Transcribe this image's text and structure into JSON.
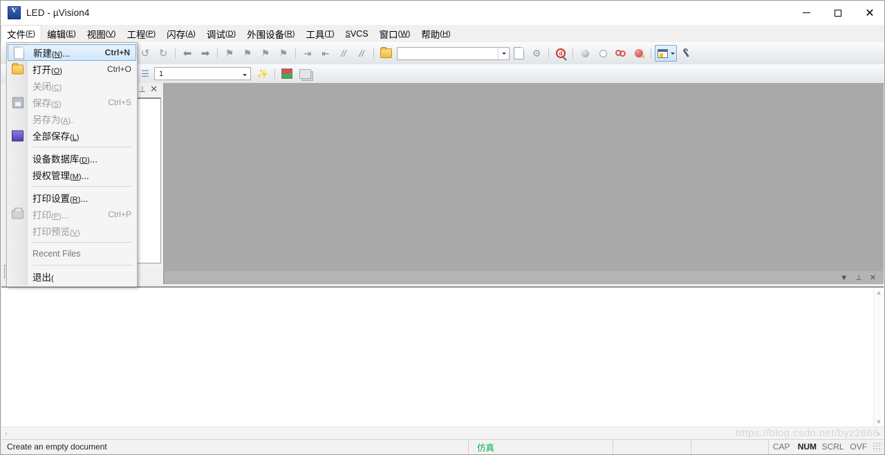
{
  "window": {
    "title": "LED  - µVision4",
    "icon": "uvision-logo-icon",
    "controls": {
      "minimize": "minimize-button",
      "maximize": "maximize-button",
      "close": "close-button"
    }
  },
  "menubar": {
    "items": [
      {
        "name": "文件",
        "key": "F",
        "open": true
      },
      {
        "name": "编辑",
        "key": "E",
        "open": false
      },
      {
        "name": "视图",
        "key": "V",
        "open": false
      },
      {
        "name": "工程",
        "key": "P",
        "open": false
      },
      {
        "name": "闪存",
        "key": "A",
        "open": false
      },
      {
        "name": "调试",
        "key": "D",
        "open": false
      },
      {
        "name": "外围设备",
        "key": "R",
        "open": false
      },
      {
        "name": "工具",
        "key": "T",
        "open": false
      },
      {
        "name": "SVCS",
        "key": "S",
        "plain": true,
        "open": false
      },
      {
        "name": "窗口",
        "key": "W",
        "open": false
      },
      {
        "name": "帮助",
        "key": "H",
        "open": false
      }
    ]
  },
  "file_menu": {
    "items": [
      {
        "label": "新建",
        "key": "N",
        "suffix": "...",
        "accel": "Ctrl+N",
        "icon": "new-document-icon",
        "state": "highlighted"
      },
      {
        "label": "打开",
        "key": "O",
        "suffix": "",
        "accel": "Ctrl+O",
        "icon": "open-folder-icon",
        "state": "enabled"
      },
      {
        "label": "关闭",
        "key": "C",
        "suffix": "",
        "accel": "",
        "icon": "",
        "state": "disabled"
      },
      {
        "label": "保存",
        "key": "S",
        "suffix": "",
        "accel": "Ctrl+S",
        "icon": "save-disk-icon",
        "state": "disabled"
      },
      {
        "label": "另存为",
        "key": "A",
        "suffix": ".",
        "accel": "",
        "icon": "",
        "state": "disabled"
      },
      {
        "label": "全部保存",
        "key": "L",
        "suffix": "",
        "accel": "",
        "icon": "save-all-icon",
        "state": "enabled"
      },
      {
        "separator": true
      },
      {
        "label": "设备数据库",
        "key": "D",
        "suffix": "...",
        "accel": "",
        "icon": "",
        "state": "enabled"
      },
      {
        "label": "授权管理",
        "key": "M",
        "suffix": "...",
        "accel": "",
        "icon": "",
        "state": "enabled"
      },
      {
        "separator": true
      },
      {
        "label": "打印设置",
        "key": "R",
        "suffix": "...",
        "accel": "",
        "icon": "",
        "state": "enabled"
      },
      {
        "label": "打印",
        "key": "P",
        "suffix": "...",
        "accel": "Ctrl+P",
        "icon": "printer-icon",
        "state": "disabled"
      },
      {
        "label": "打印预览",
        "key": "V",
        "suffix": "",
        "accel": "",
        "icon": "",
        "state": "disabled"
      },
      {
        "separator": true
      },
      {
        "label": "Recent Files",
        "key": "",
        "suffix": "",
        "accel": "",
        "icon": "",
        "state": "section"
      },
      {
        "separator": true
      },
      {
        "label": "退出",
        "key": "",
        "suffix": "(",
        "accel": "",
        "icon": "",
        "state": "enabled"
      }
    ]
  },
  "toolbar_main": {
    "buttons": [
      {
        "name": "undo-button",
        "glyph": "↺"
      },
      {
        "name": "redo-button",
        "glyph": "↻"
      },
      {
        "name": "navigate-backward-button",
        "glyph": "⬅"
      },
      {
        "name": "navigate-forward-button",
        "glyph": "➡"
      },
      {
        "name": "bookmark-toggle-button",
        "glyph": "⚑"
      },
      {
        "name": "bookmark-next-button",
        "glyph": "⚑"
      },
      {
        "name": "bookmark-prev-button",
        "glyph": "⚑"
      },
      {
        "name": "bookmark-clear-button",
        "glyph": "⚑"
      },
      {
        "name": "indent-button",
        "glyph": "⇥"
      },
      {
        "name": "outdent-button",
        "glyph": "⇤"
      },
      {
        "name": "comment-button",
        "glyph": "//"
      },
      {
        "name": "uncomment-button",
        "glyph": "//"
      },
      {
        "name": "open-file-browse-button",
        "glyph": "📂"
      }
    ],
    "search_box": {
      "value": "",
      "placeholder": ""
    },
    "right_buttons": [
      {
        "name": "find-in-files-button",
        "glyph": "🔍"
      },
      {
        "name": "configure-target-button",
        "glyph": "🔧"
      },
      {
        "name": "debug-magnifier-button",
        "glyph": "d"
      },
      {
        "name": "breakpoint-insert-button",
        "glyph": "●"
      },
      {
        "name": "breakpoint-disable-button",
        "glyph": "○"
      },
      {
        "name": "breakpoint-disable-all-button",
        "glyph": "◌"
      },
      {
        "name": "breakpoint-kill-all-button",
        "glyph": "✕"
      },
      {
        "name": "project-window-toggle-button",
        "glyph": "▤",
        "active": true
      },
      {
        "name": "configuration-wizard-button",
        "glyph": "🔧"
      }
    ]
  },
  "toolbar_build": {
    "target_selector": {
      "value": "1",
      "placeholder": ""
    },
    "buttons": [
      {
        "name": "target-options-button",
        "glyph": "🎯"
      },
      {
        "name": "manage-components-button",
        "glyph": "▣"
      },
      {
        "name": "batch-build-button",
        "glyph": "▤"
      }
    ]
  },
  "project_panel": {
    "pin_icon": "pin-icon",
    "close_icon": "close-icon",
    "tabs": [
      {
        "label": "...",
        "icon": "project-tree-icon"
      }
    ]
  },
  "mdi": {
    "restore_icon": "chevron-down-icon",
    "pin_icon": "pin-icon",
    "close_icon": "close-icon"
  },
  "scrollbars": {
    "h_left_icon": "‹",
    "h_right_icon": "›",
    "v_up_icon": "▲",
    "v_down_icon": "▼"
  },
  "statusbar": {
    "message": "Create an empty document",
    "simulation": "仿真",
    "indicators": [
      {
        "label": "CAP",
        "on": false
      },
      {
        "label": "NUM",
        "on": true
      },
      {
        "label": "SCRL",
        "on": false
      },
      {
        "label": "OVF",
        "on": false
      }
    ],
    "grip": "resize-grip"
  },
  "watermark": "https://blog.csdn.net/byz2666",
  "colors": {
    "accent": "#3a6ea5",
    "highlight": "#d2e8fa",
    "sim_green": "#00b050",
    "workspace_gray": "#a9a9a9"
  }
}
